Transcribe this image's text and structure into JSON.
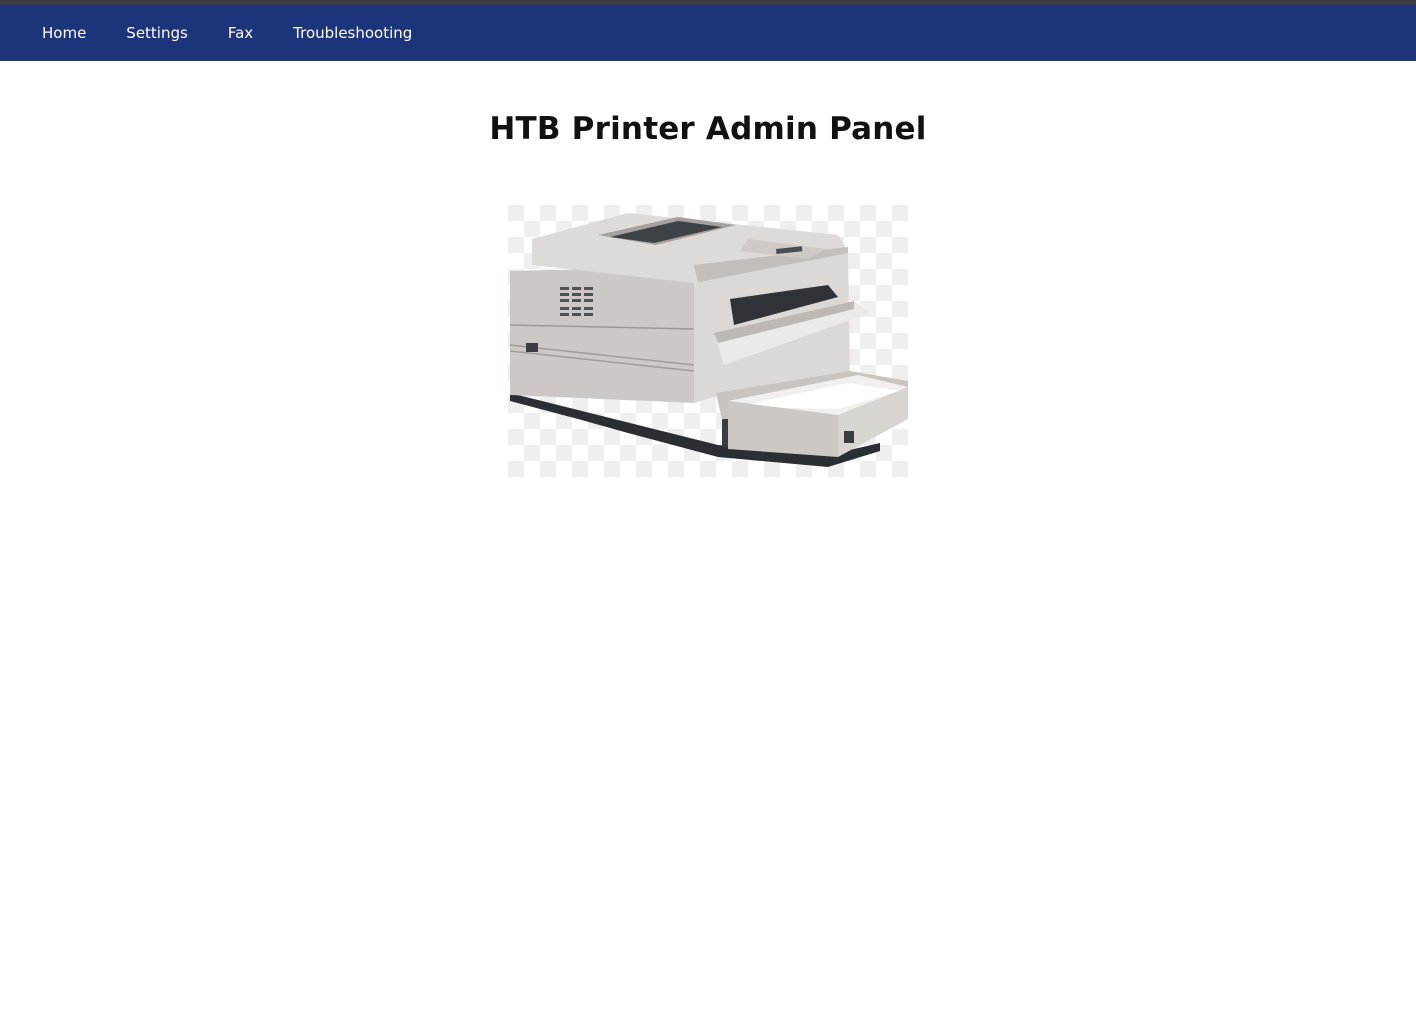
{
  "nav": {
    "items": [
      {
        "label": "Home"
      },
      {
        "label": "Settings"
      },
      {
        "label": "Fax"
      },
      {
        "label": "Troubleshooting"
      }
    ]
  },
  "main": {
    "title": "HTB Printer Admin Panel"
  },
  "colors": {
    "navbar": "#1b347a",
    "nav_text": "#ffffff",
    "title": "#111111"
  }
}
